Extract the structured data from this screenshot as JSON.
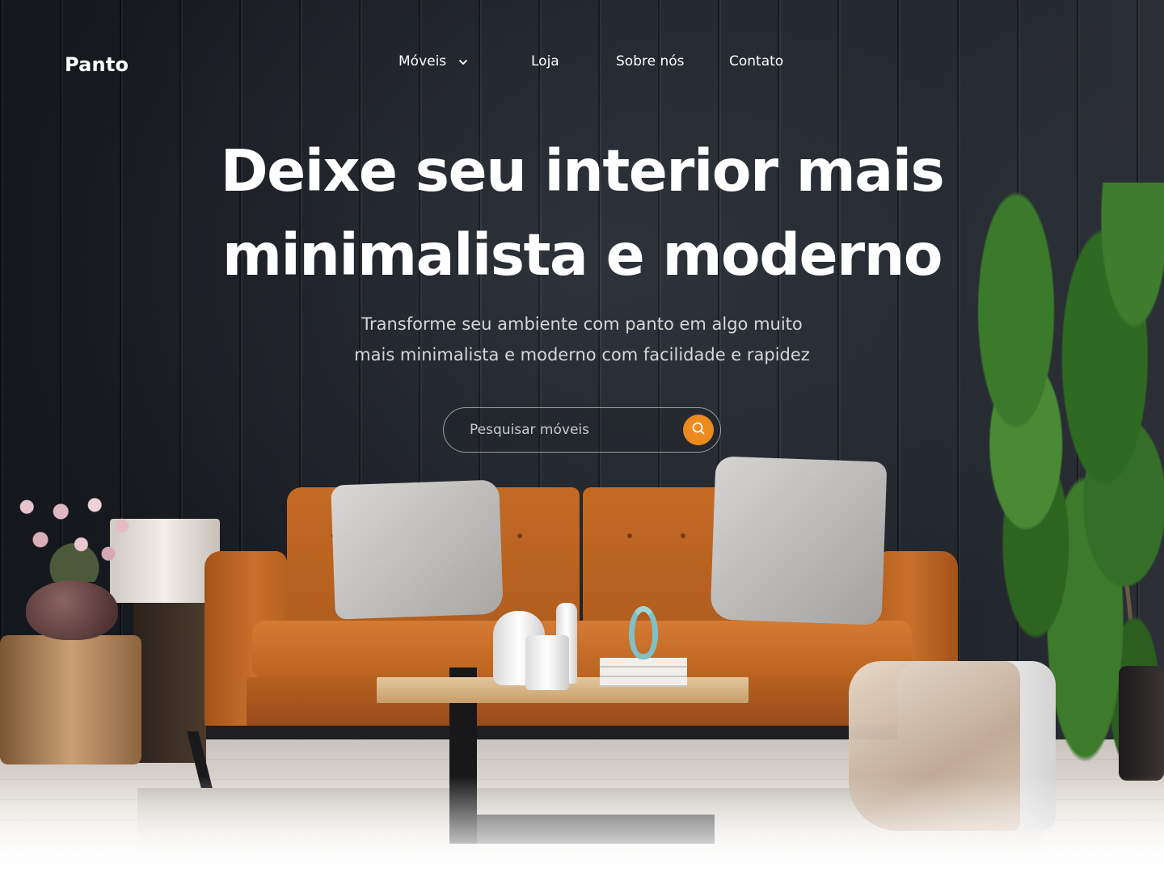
{
  "brand": {
    "logo": "Panto",
    "accent": "#EC8A1E"
  },
  "nav": {
    "items": [
      {
        "label": "Móveis",
        "has_dropdown": true,
        "icon": "chevron-down-icon"
      },
      {
        "label": "Loja"
      },
      {
        "label": "Sobre nós"
      },
      {
        "label": "Contato"
      }
    ]
  },
  "hero": {
    "headline_line1": "Deixe seu interior mais",
    "headline_line2": "minimalista e moderno",
    "subtitle_line1": "Transforme seu ambiente com panto em algo muito",
    "subtitle_line2": "mais minimalista e moderno com facilidade e rapidez"
  },
  "search": {
    "placeholder": "Pesquisar móveis",
    "value": "",
    "button_icon": "search-icon"
  }
}
